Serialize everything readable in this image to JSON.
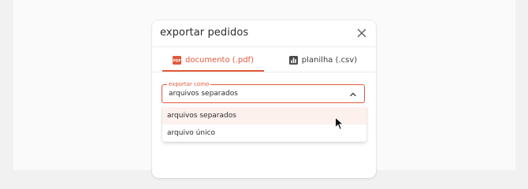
{
  "dialog": {
    "title": "exportar pedidos",
    "close_icon": "close-icon"
  },
  "tabs": [
    {
      "label": "documento (.pdf)",
      "icon": "pdf-icon",
      "active": true
    },
    {
      "label": "planilha (.csv)",
      "icon": "bar-chart-icon",
      "active": false
    }
  ],
  "select": {
    "label": "exportar como",
    "value": "arquivos separados",
    "icon": "chevron-up-icon",
    "options": [
      "arquivos separados",
      "arquivo único"
    ],
    "highlighted_option": "arquivos separados"
  },
  "colors": {
    "accent": "#e2583a",
    "highlight": "#fdf1ed",
    "text": "#2c2c2c"
  }
}
